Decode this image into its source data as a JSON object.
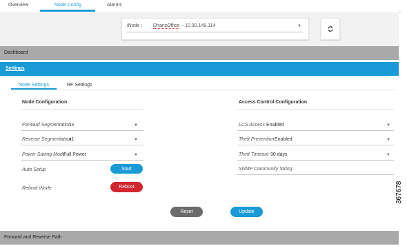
{
  "top_tabs": [
    {
      "label": "Overview",
      "active": false
    },
    {
      "label": "Node Config",
      "active": true
    },
    {
      "label": "Alarms",
      "active": false
    }
  ],
  "inode_selector": {
    "label": "iNode :",
    "value_name": "DhansOffice",
    "value_rest": " – 10.90.149.114",
    "icon": "chevron-down-icon"
  },
  "refresh": {
    "icon": "refresh-icon"
  },
  "sections": {
    "dashboard": "Dashboard",
    "settings": "Settings",
    "forward_reverse": "Forward and Reverse Path"
  },
  "sub_tabs": [
    {
      "label": "Node Settings",
      "active": true
    },
    {
      "label": "RF Settings",
      "active": false
    }
  ],
  "node_config": {
    "title": "Node Configuration",
    "forward_segmentation": {
      "label": "Forward Segmentation",
      "value": "1x"
    },
    "reverse_segmentation": {
      "label": "Reverse Segmentation",
      "value": "x1"
    },
    "power_saving_mode": {
      "label": "Power Saving Mode",
      "value": "Full Power"
    },
    "auto_setup": {
      "label": "Auto Setup",
      "button": "Start"
    },
    "reboot": {
      "label": "Reboot iNode",
      "button": "Reboot"
    }
  },
  "access_control": {
    "title": "Access Control Configuration",
    "lcs_access": {
      "label": "LCS Access",
      "value": "Enabled"
    },
    "theft_prevention": {
      "label": "Theft Prevention",
      "value": "Enabled"
    },
    "theft_timeout": {
      "label": "Theft Timeout",
      "value": "90 days"
    },
    "snmp": {
      "label": "SNMP Community String",
      "value": ""
    }
  },
  "actions": {
    "reset": "Reset",
    "update": "Update"
  },
  "figure_number": "367678",
  "colors": {
    "accent": "#1a9ad6",
    "danger": "#d22730",
    "neutral": "#6b6b6b",
    "section_bar": "#a9a9a9"
  }
}
